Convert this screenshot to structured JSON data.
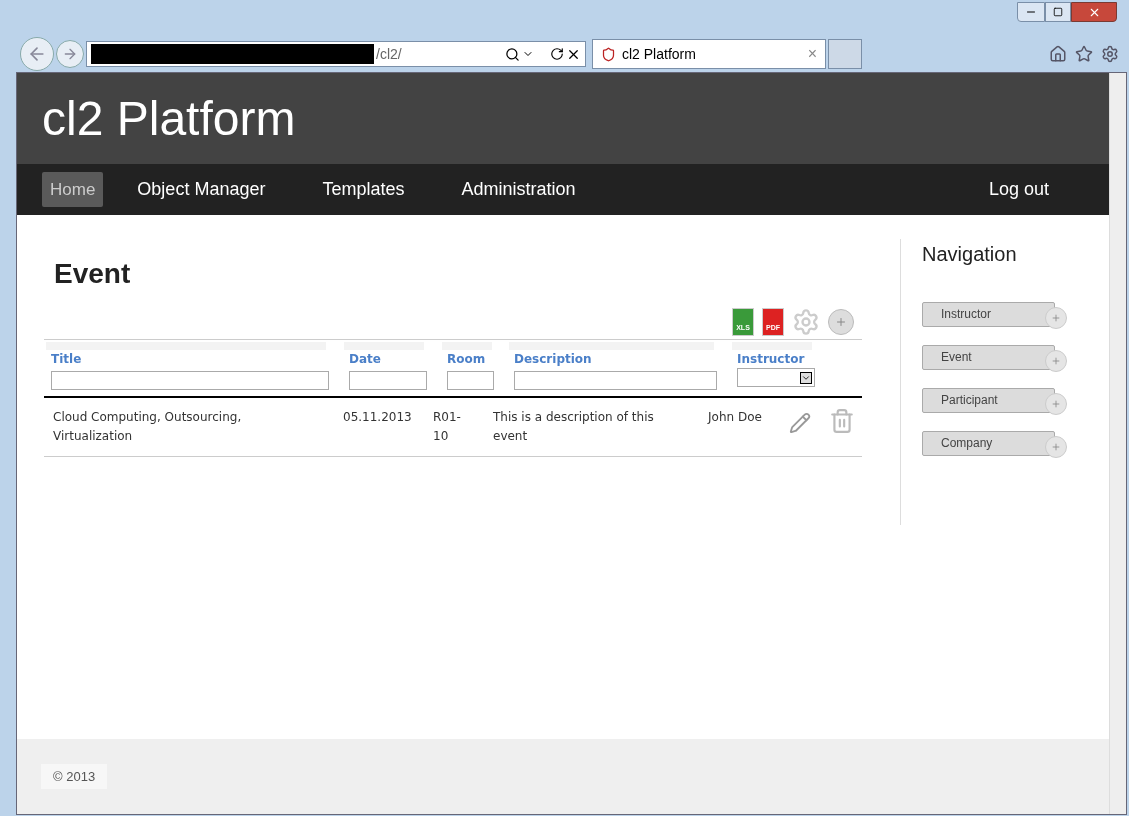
{
  "browser": {
    "address_suffix": "/cl2/",
    "tab": {
      "title": "cl2 Platform",
      "close": "×"
    }
  },
  "site": {
    "title": "cl2 Platform"
  },
  "nav": [
    {
      "label": "Home",
      "selected": true
    },
    {
      "label": "Object Manager",
      "selected": false
    },
    {
      "label": "Templates",
      "selected": false
    },
    {
      "label": "Administration",
      "selected": false
    }
  ],
  "logout": "Log out",
  "page": {
    "heading": "Event",
    "exports": [
      "XLS",
      "PDF"
    ]
  },
  "table": {
    "columns": [
      {
        "label": "Title",
        "kind": "text"
      },
      {
        "label": "Date",
        "kind": "text"
      },
      {
        "label": "Room",
        "kind": "text"
      },
      {
        "label": "Description",
        "kind": "text"
      },
      {
        "label": "Instructor",
        "kind": "select"
      }
    ],
    "rows": [
      {
        "cells": [
          "Cloud Computing, Outsourcing, Virtualization",
          "05.11.2013",
          "R01-10",
          "This is a description of this event",
          "John Doe"
        ]
      }
    ]
  },
  "sidebar": {
    "title": "Navigation",
    "items": [
      "Instructor",
      "Event",
      "Participant",
      "Company"
    ]
  },
  "footer": "© 2013"
}
